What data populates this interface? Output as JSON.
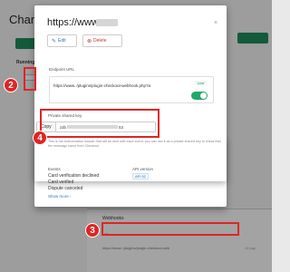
{
  "background": {
    "title": "Channe",
    "running_label": "Running",
    "webhooks_heading": "Webhooks",
    "url_header": "URL",
    "row_url_visible": "https://www.              /plugins/plugin-checkout-web",
    "row_right_text": "24 pay"
  },
  "modal": {
    "title": "https://www.",
    "close_glyph": "×",
    "edit_label": "Edit",
    "delete_label": "Delete",
    "endpoint_label": "Endpoint URL",
    "endpoint_value": "https://www.                                      /plugins/plugin-checkout-webhook.php?a",
    "live_label": "Live",
    "live_toggle_on": true,
    "shared_key_label": "Private shared key",
    "copy_label": "Copy",
    "key_prefix": "zdb",
    "key_suffix": "53",
    "help_text": "This is the Authorization header that will be sent with each event, you can use it as a private shared key to check that the message came from Checkout",
    "events_label": "Events",
    "events": [
      "Card verification declined",
      "Card verified",
      "Dispute canceled"
    ],
    "show_more": "Show more",
    "api_version_label": "API version",
    "api_version": "API  52"
  },
  "annotations": [
    "2",
    "4",
    "3"
  ],
  "colors": {
    "annotation": "#e02424",
    "accent_green": "#1fa86a",
    "link_blue": "#2a7ab8"
  }
}
